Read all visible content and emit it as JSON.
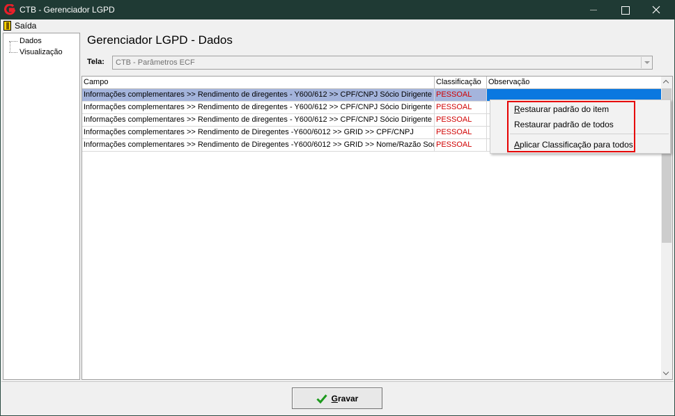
{
  "window": {
    "title": "CTB - Gerenciador LGPD",
    "accent": "#1f3a34",
    "controls": [
      "minimize-icon",
      "maximize-icon",
      "close-icon"
    ]
  },
  "menubar": {
    "items": [
      {
        "label": "Saída",
        "icon": "exit-icon"
      }
    ]
  },
  "tree": {
    "items": [
      {
        "label": "Dados"
      },
      {
        "label": "Visualização"
      }
    ]
  },
  "page": {
    "heading": "Gerenciador LGPD - Dados",
    "tela_label": "Tela:",
    "tela_value": "CTB - Parâmetros ECF"
  },
  "grid": {
    "columns": [
      "Campo",
      "Classificação",
      "Observação"
    ],
    "rows": [
      {
        "campo": "Informações complementares >> Rendimento de diregentes - Y600/612 >> CPF/CNPJ Sócio Dirigente",
        "classificacao": "PESSOAL",
        "observacao": "",
        "selected": true
      },
      {
        "campo": "Informações complementares >> Rendimento de diregentes - Y600/612 >> CPF/CNPJ Sócio Dirigente >...",
        "classificacao": "PESSOAL",
        "observacao": ""
      },
      {
        "campo": "Informações complementares >> Rendimento de diregentes - Y600/612 >> CPF/CNPJ Sócio Dirigente >...",
        "classificacao": "PESSOAL",
        "observacao": ""
      },
      {
        "campo": "Informações complementares >> Rendimento de Diregentes -Y600/6012 >> GRID >> CPF/CNPJ",
        "classificacao": "PESSOAL",
        "observacao": ""
      },
      {
        "campo": "Informações complementares >> Rendimento de Diregentes -Y600/6012 >> GRID >> Nome/Razão Social",
        "classificacao": "PESSOAL",
        "observacao": ""
      }
    ],
    "classification_color": "#d00000"
  },
  "context_menu": {
    "items": [
      {
        "label": "Restaurar padrão do item",
        "mnemonic": "R",
        "rest": "estaurar padrão do item"
      },
      {
        "label": "Restaurar padrão de todos",
        "mnemonic": "",
        "rest": "Restaurar padrão de todos"
      },
      {
        "label": "Aplicar Classificação para todos",
        "mnemonic": "A",
        "rest": "plicar Classificação para todos"
      }
    ],
    "highlight_color": "#e60000"
  },
  "footer": {
    "save_mnemonic": "G",
    "save_rest": "ravar",
    "save_label": "Gravar",
    "save_icon": "check-icon"
  }
}
